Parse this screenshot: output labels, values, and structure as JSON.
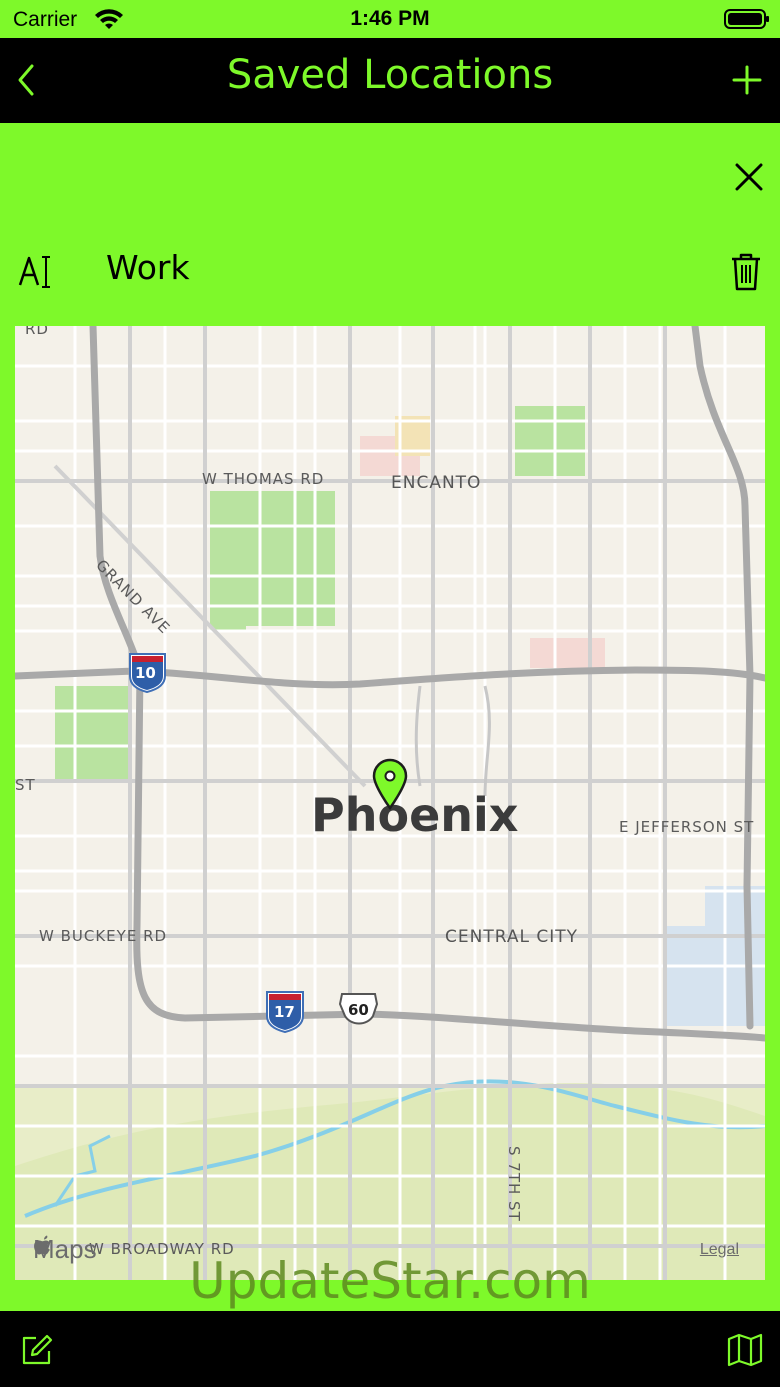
{
  "status_bar": {
    "carrier": "Carrier",
    "time": "1:46 PM"
  },
  "nav": {
    "title": "Saved Locations"
  },
  "location": {
    "name": "Work"
  },
  "map": {
    "labels": {
      "rd_top": "RD",
      "thomas": "W THOMAS RD",
      "encanto": "ENCANTO",
      "grand": "GRAND AVE",
      "i10": "10",
      "st_left": "ST",
      "city": "Phoenix",
      "jefferson": "E JEFFERSON ST",
      "buckeye": "W BUCKEYE RD",
      "central": "CENTRAL CITY",
      "i17": "17",
      "us60": "60",
      "s7th": "S 7TH ST",
      "broadway": "W BROADWAY RD",
      "maps": "Maps",
      "legal": "Legal"
    }
  },
  "watermark": "UpdateStar.com",
  "colors": {
    "accent": "#7ef92a",
    "bar": "#000000"
  }
}
